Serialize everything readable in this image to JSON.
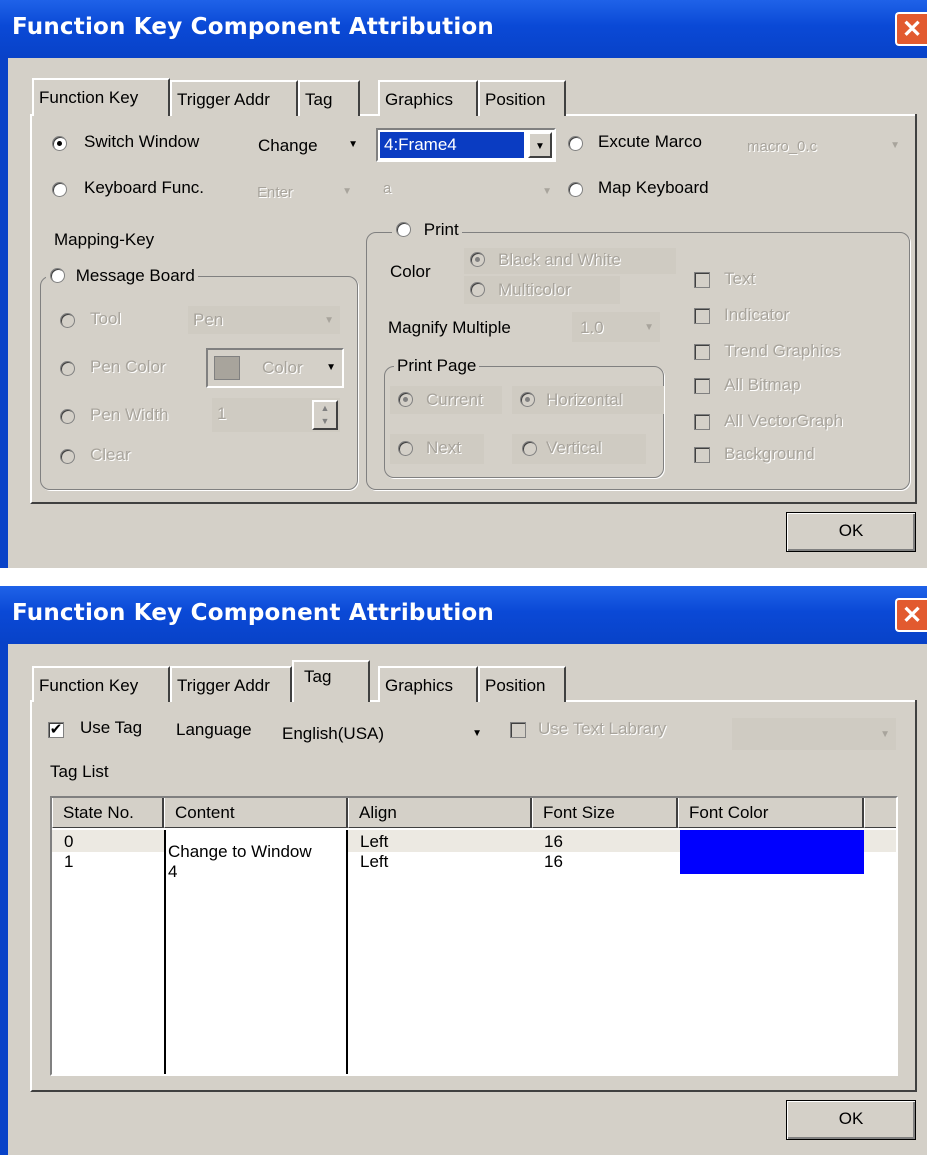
{
  "colors": {
    "title_bar": "#0a49d6",
    "font_color_swatch": "#0000ff",
    "dialog_bg": "#d4d0c8"
  },
  "dialog1": {
    "title": "Function Key Component Attribution",
    "tabs": [
      "Function Key",
      "Trigger Addr",
      "Tag",
      "Graphics",
      "Position"
    ],
    "active_tab": "Function Key",
    "switch_window": {
      "label": "Switch Window",
      "mode": "Change",
      "frame": "4:Frame4",
      "selected": true
    },
    "execute_macro": {
      "label": "Excute Marco",
      "value": "macro_0.c"
    },
    "keyboard_func": {
      "label": "Keyboard Func.",
      "key": "Enter",
      "char": "a"
    },
    "map_keyboard": {
      "label": "Map Keyboard"
    },
    "mapping_key_label": "Mapping-Key",
    "message_board": {
      "label": "Message Board",
      "tool_label": "Tool",
      "tool_value": "Pen",
      "pen_color_label": "Pen Color",
      "color_value": "Color",
      "pen_width_label": "Pen Width",
      "pen_width_value": "1",
      "clear_label": "Clear"
    },
    "print": {
      "label": "Print",
      "color_label": "Color",
      "black_white": "Black and White",
      "multicolor": "Multicolor",
      "magnify_label": "Magnify Multiple",
      "magnify_value": "1.0",
      "print_page_label": "Print Page",
      "current": "Current",
      "horizontal": "Horizontal",
      "next": "Next",
      "vertical": "Vertical"
    },
    "print_items": [
      "Text",
      "Indicator",
      "Trend Graphics",
      "All Bitmap",
      "All VectorGraph",
      "Background"
    ],
    "ok_label": "OK"
  },
  "dialog2": {
    "title": "Function Key Component Attribution",
    "tabs": [
      "Function Key",
      "Trigger Addr",
      "Tag",
      "Graphics",
      "Position"
    ],
    "active_tab": "Tag",
    "use_tag_label": "Use Tag",
    "use_tag_checked": true,
    "language_label": "Language",
    "language_value": "English(USA)",
    "use_text_library_label": "Use Text Labrary",
    "tag_list_label": "Tag List",
    "columns": [
      "State No.",
      "Content",
      "Align",
      "Font Size",
      "Font Color"
    ],
    "rows": [
      {
        "state": "0",
        "align": "Left",
        "font_size": "16"
      },
      {
        "state": "1",
        "align": "Left",
        "font_size": "16"
      }
    ],
    "content_lines": [
      "Change to Window",
      "4"
    ],
    "ok_label": "OK"
  }
}
